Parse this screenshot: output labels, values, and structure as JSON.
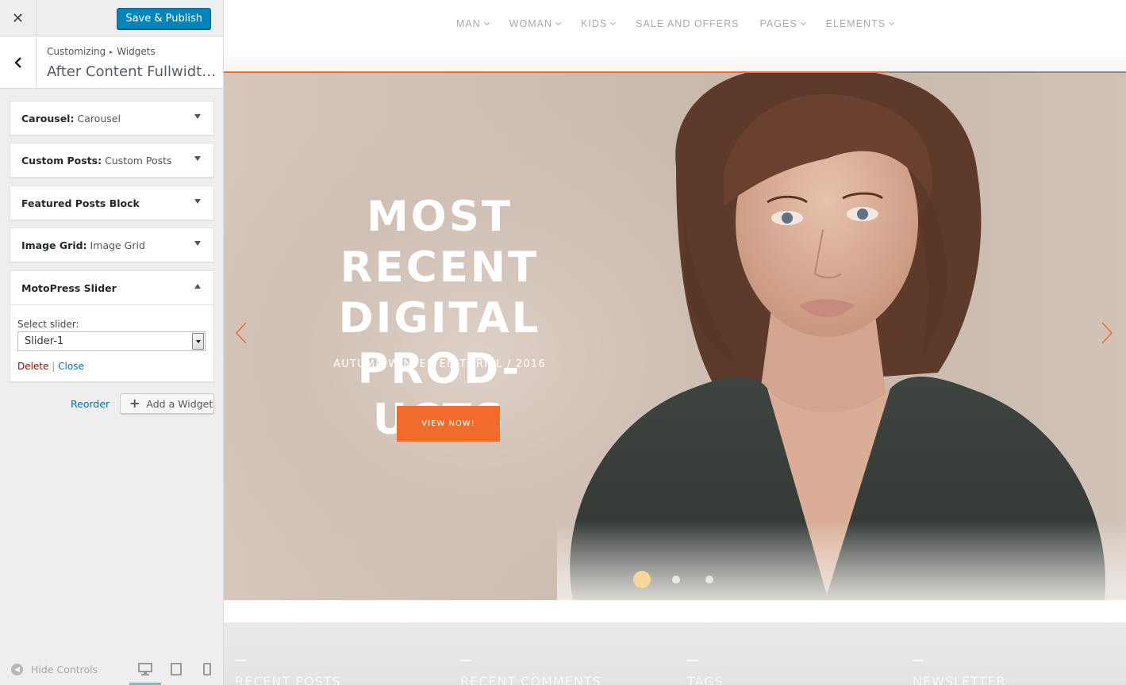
{
  "sidebar": {
    "close_label": "✕",
    "publish_label": "Save & Publish",
    "breadcrumb": {
      "root": "Customizing",
      "separator": "▸",
      "current": "Widgets"
    },
    "section_title": "After Content Fullwidth ...",
    "widgets": [
      {
        "title": "Carousel",
        "subtitle": "Carousel",
        "expanded": false
      },
      {
        "title": "Custom Posts",
        "subtitle": "Custom Posts",
        "expanded": false
      },
      {
        "title": "Featured Posts Block",
        "subtitle": "",
        "expanded": false
      },
      {
        "title": "Image Grid",
        "subtitle": "Image Grid",
        "expanded": false
      },
      {
        "title": "MotoPress Slider",
        "subtitle": "",
        "expanded": true
      }
    ],
    "slider_widget": {
      "select_label": "Select slider:",
      "selected_value": "Slider-1",
      "delete_label": "Delete",
      "separator": "|",
      "close_label": "Close"
    },
    "reorder_label": "Reorder",
    "add_widget_label": "Add a Widget",
    "footer": {
      "hide_controls_label": "Hide Controls",
      "active_device": "desktop"
    }
  },
  "preview": {
    "nav": [
      {
        "label": "MAN",
        "dropdown": true
      },
      {
        "label": "WOMAN",
        "dropdown": true
      },
      {
        "label": "KIDS",
        "dropdown": true
      },
      {
        "label": "SALE AND OFFERS",
        "dropdown": false
      },
      {
        "label": "PAGES",
        "dropdown": true
      },
      {
        "label": "ELEMENTS",
        "dropdown": true
      }
    ],
    "hero": {
      "title_lines": [
        "MOST RECENT",
        "DIGITAL PROD-",
        "UCTS"
      ],
      "subtitle": "AUTUMN WINTER EDITORIAL / 2016",
      "cta_label": "VIEW NOW!",
      "progress": 0.735,
      "slide_count": 3,
      "active_slide": 0
    },
    "footer_columns": [
      "RECENT POSTS",
      "RECENT COMMENTS",
      "TAGS",
      "NEWSLETTER"
    ]
  },
  "colors": {
    "primary_button": "#0085ba",
    "accent": "#f26b2a",
    "dot_active": "#f5d79a",
    "link": "#0073aa",
    "delete": "#aa0000"
  }
}
